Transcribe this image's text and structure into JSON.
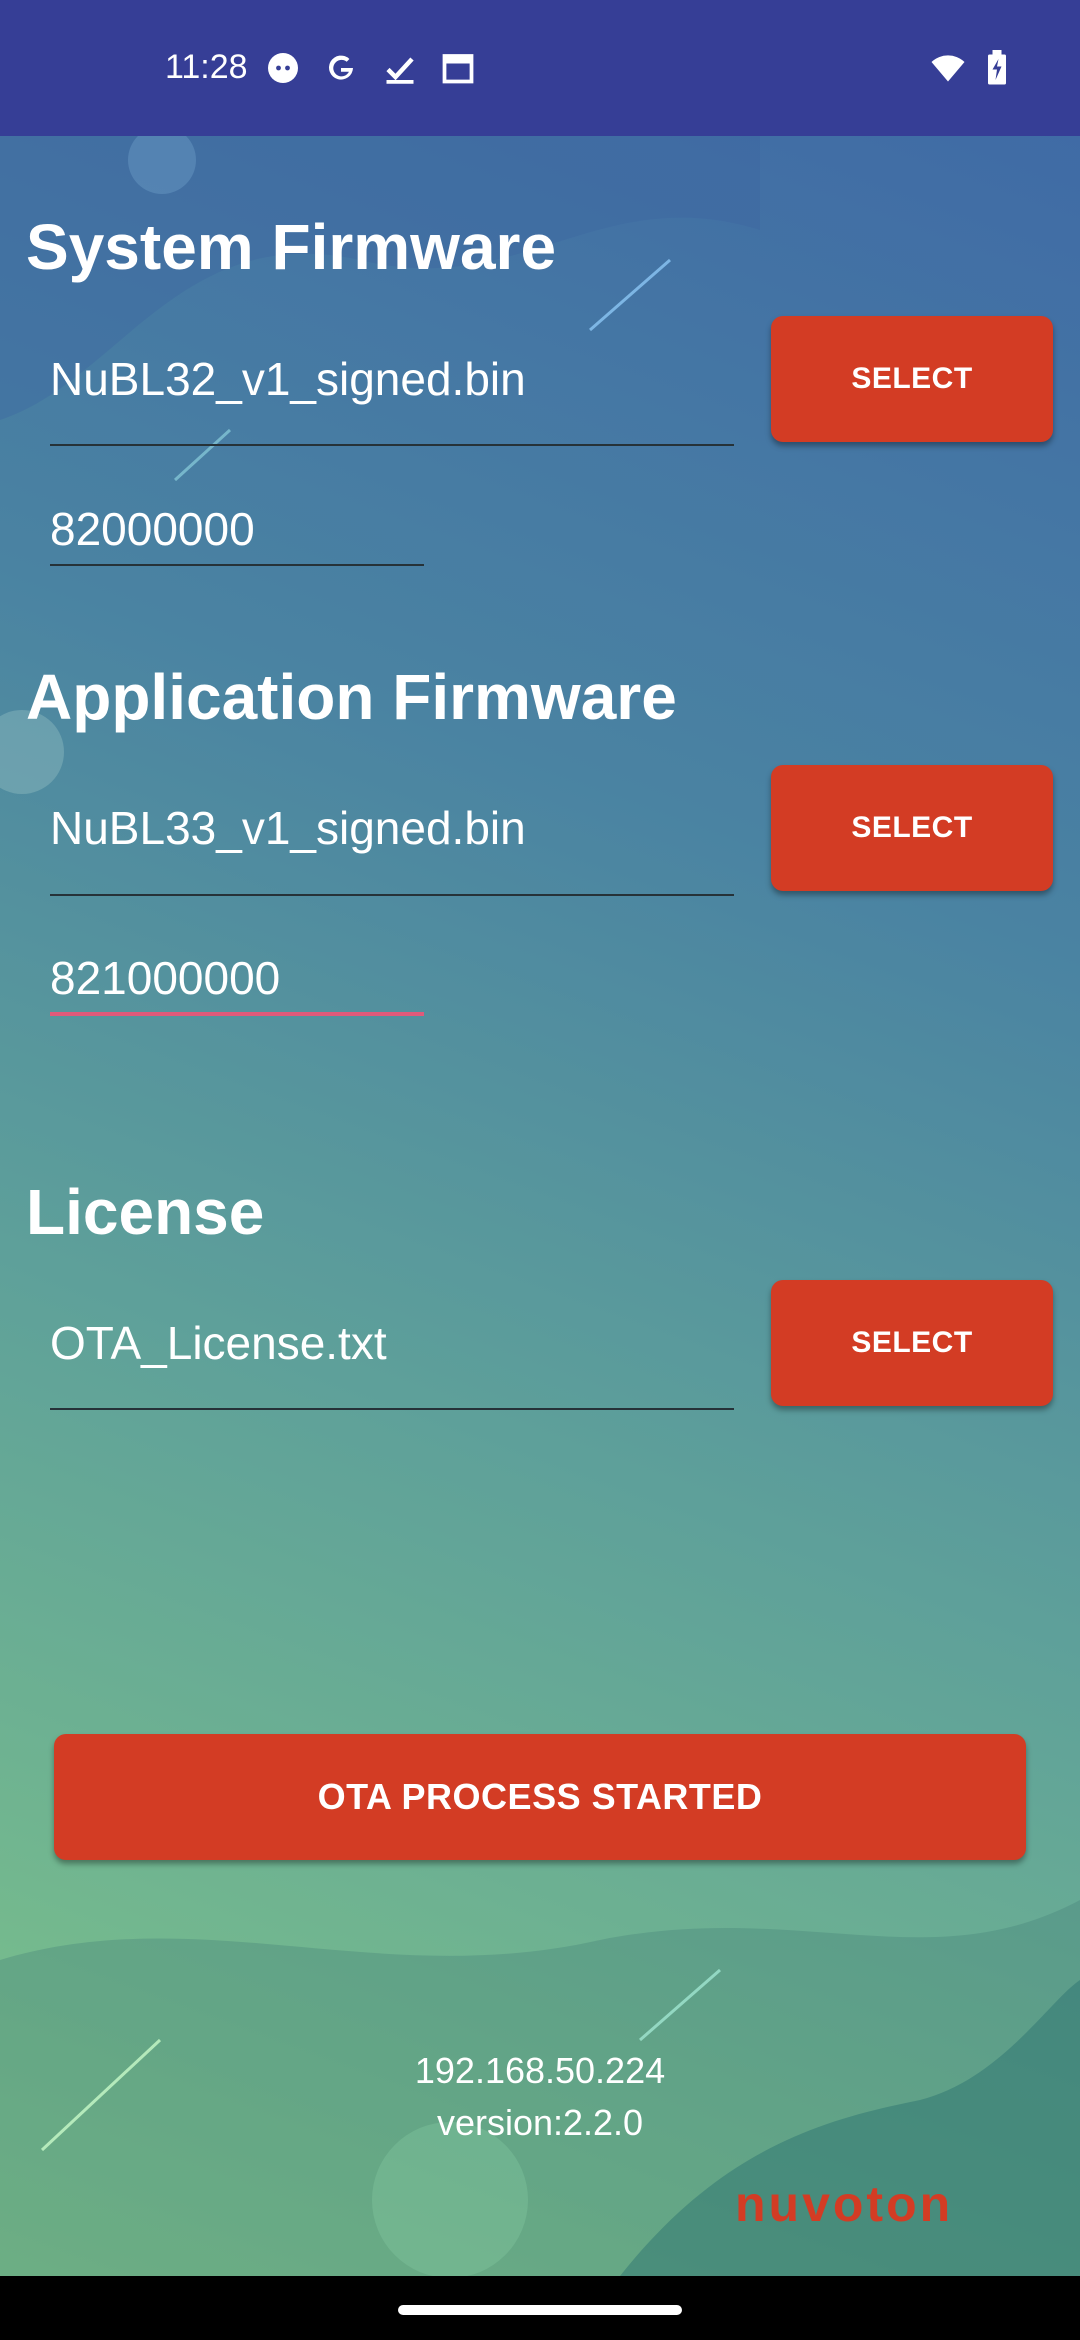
{
  "status_bar": {
    "time": "11:28",
    "icons": [
      "face-icon",
      "google-icon",
      "task-done-icon",
      "calendar-icon"
    ],
    "right_icons": [
      "wifi-icon",
      "battery-charging-icon"
    ]
  },
  "system_firmware": {
    "title": "System Firmware",
    "file_value": "NuBL32_v1_signed.bin",
    "address_value": "82000000",
    "select_label": "SELECT"
  },
  "application_firmware": {
    "title": "Application Firmware",
    "file_value": "NuBL33_v1_signed.bin",
    "address_value": "821000000",
    "select_label": "SELECT"
  },
  "license": {
    "title": "License",
    "file_value": "OTA_License.txt",
    "select_label": "SELECT"
  },
  "ota_button_label": "OTA PROCESS STARTED",
  "footer": {
    "ip": "192.168.50.224",
    "version": "version:2.2.0",
    "logo_text": "nuvoton"
  },
  "colors": {
    "status_bar": "#363e96",
    "button": "#d33c24",
    "focused_underline": "#e05a7a"
  }
}
